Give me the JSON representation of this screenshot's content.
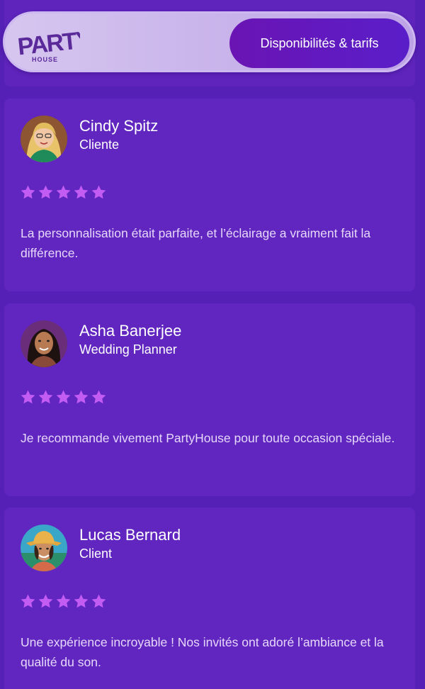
{
  "header": {
    "logo_text": "PARTY",
    "logo_subtext": "HOUSE",
    "cta_label": "Disponibilités & tarifs"
  },
  "colors": {
    "background": "#5520b5",
    "card": "#6125c0",
    "star": "#c25cf2",
    "cta": "#6a14b4"
  },
  "reviews": [
    {
      "name": "Cindy Spitz",
      "role": "Cliente",
      "rating": 5,
      "text": "La personnalisation était parfaite, et l’éclairage a vraiment fait la différence."
    },
    {
      "name": "Asha Banerjee",
      "role": "Wedding Planner",
      "rating": 5,
      "text": "Je recommande vivement PartyHouse pour toute occasion spéciale."
    },
    {
      "name": "Lucas Bernard",
      "role": "Client",
      "rating": 5,
      "text": "Une expérience incroyable ! Nos invités ont adoré l’ambiance et la qualité du son."
    }
  ]
}
